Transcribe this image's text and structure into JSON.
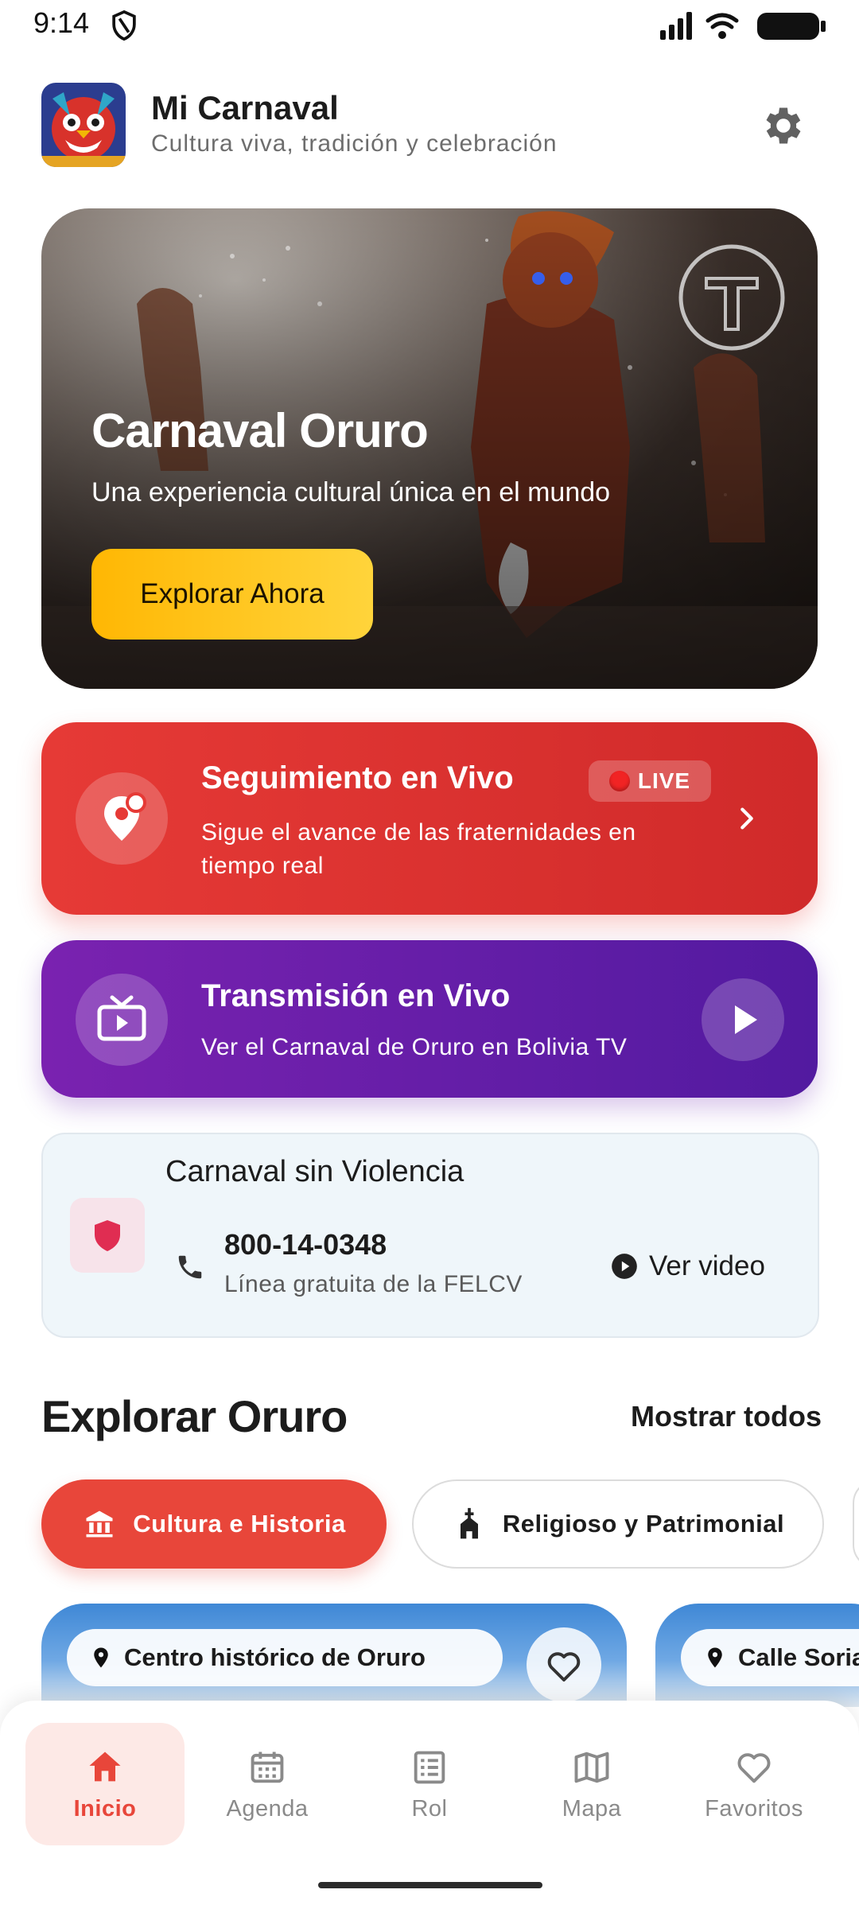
{
  "status_bar": {
    "time": "9:14"
  },
  "header": {
    "title": "Mi Carnaval",
    "subtitle": "Cultura viva, tradición y celebración"
  },
  "hero": {
    "title": "Carnaval Oruro",
    "subtitle": "Una experiencia cultural única en el mundo",
    "button_label": "Explorar Ahora"
  },
  "live_tracking": {
    "title": "Seguimiento en Vivo",
    "badge": "LIVE",
    "description_line1": "Sigue el avance de las fraternidades en",
    "description_line2": "tiempo real",
    "accent": "#e63a36"
  },
  "tv": {
    "title": "Transmisión en Vivo",
    "description": "Ver el Carnaval de Oruro en Bolivia TV",
    "accent": "#6a1fb0"
  },
  "no_violence": {
    "title": "Carnaval sin Violencia",
    "phone": "800-14-0348",
    "phone_desc": "Línea gratuita de la FELCV",
    "video_label": "Ver video"
  },
  "explore": {
    "title": "Explorar Oruro",
    "show_all": "Mostrar todos",
    "chips": [
      {
        "label": "Cultura e Historia",
        "icon": "museum-icon",
        "active": true
      },
      {
        "label": "Religioso y Patrimonial",
        "icon": "church-icon",
        "active": false
      }
    ],
    "places": [
      {
        "location": "Centro histórico de Oruro"
      },
      {
        "location": "Calle Soria"
      }
    ]
  },
  "bottom_nav": {
    "items": [
      {
        "label": "Inicio",
        "icon": "home-icon",
        "active": true
      },
      {
        "label": "Agenda",
        "icon": "calendar-icon",
        "active": false
      },
      {
        "label": "Rol",
        "icon": "list-icon",
        "active": false
      },
      {
        "label": "Mapa",
        "icon": "map-icon",
        "active": false
      },
      {
        "label": "Favoritos",
        "icon": "heart-icon",
        "active": false
      }
    ]
  },
  "colors": {
    "primary": "#e8463a",
    "hero_button": "#ffc107"
  }
}
